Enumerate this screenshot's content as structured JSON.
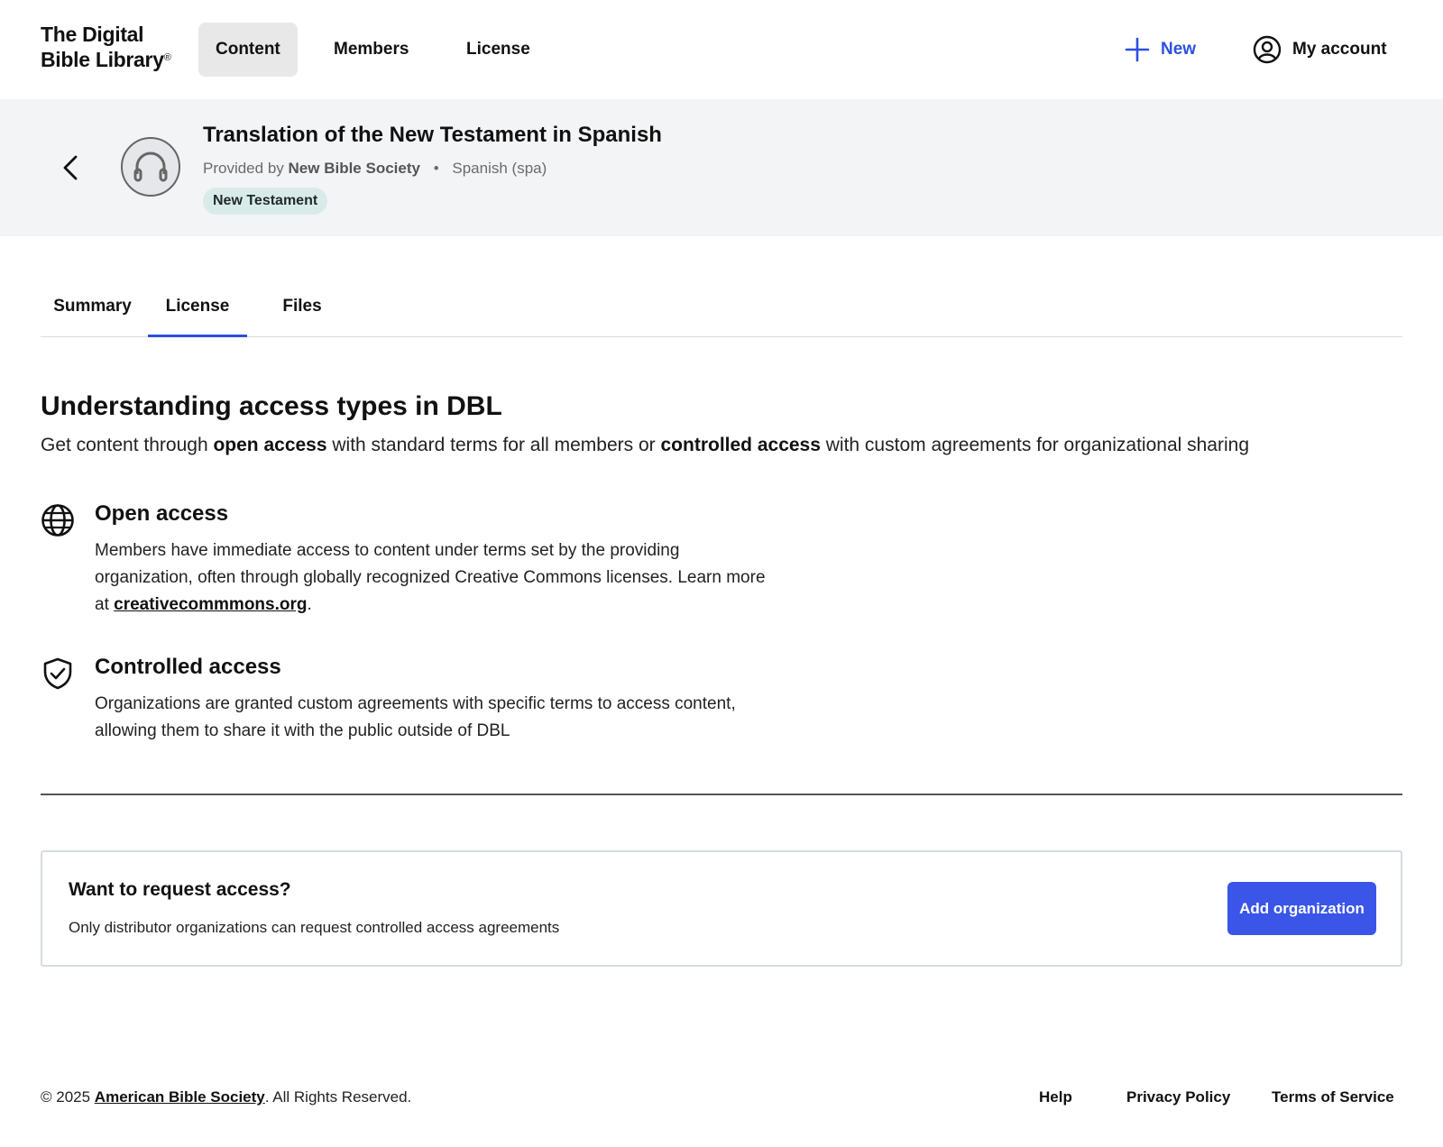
{
  "nav": {
    "logo_line1": "The Digital",
    "logo_line2": "Bible Library",
    "logo_mark": "®",
    "tabs": [
      {
        "label": "Content",
        "active": true
      },
      {
        "label": "Members",
        "active": false
      },
      {
        "label": "License",
        "active": false
      }
    ],
    "new_label": "New",
    "account_label": "My account",
    "accent_color": "#2d4fe0"
  },
  "header": {
    "title": "Translation of the New Testament in Spanish",
    "provided_by_prefix": "Provided by",
    "provider": "New Bible Society",
    "separator": "•",
    "language": "Spanish (spa)",
    "tag": "New Testament",
    "media_icon": "headphones-icon",
    "back_icon": "chevron-left-icon"
  },
  "tabs": [
    {
      "label": "Summary",
      "active": false
    },
    {
      "label": "License",
      "active": true
    },
    {
      "label": "Files",
      "active": false
    }
  ],
  "main": {
    "heading": "Understanding access types in DBL",
    "intro_1": "Get content through ",
    "intro_open": "open access",
    "intro_2": " with standard terms for all members or ",
    "intro_controlled": "controlled access",
    "intro_3": " with custom agreements for organizational sharing",
    "open_access": {
      "title": "Open access",
      "desc_1": "Members have immediate access to content under terms set by the providing organization, often through globally recognized Creative Commons licenses. Learn more at ",
      "link": "creativecommmons.org",
      "desc_2": ".",
      "icon": "globe-icon"
    },
    "controlled_access": {
      "title": "Controlled access",
      "desc": "Organizations are granted custom agreements with specific terms to access content, allowing them to share it with the public outside of DBL",
      "icon": "shield-check-icon"
    }
  },
  "request": {
    "title": "Want to request access?",
    "subtitle": "Only distributor organizations can request controlled access agreements",
    "button": "Add organization",
    "button_color": "#3a55e8"
  },
  "footer": {
    "copy_prefix": "© 2025 ",
    "org": "American Bible Society",
    "copy_suffix": ". All Rights Reserved.",
    "links": [
      "Help",
      "Privacy Policy",
      "Terms of Service"
    ]
  }
}
